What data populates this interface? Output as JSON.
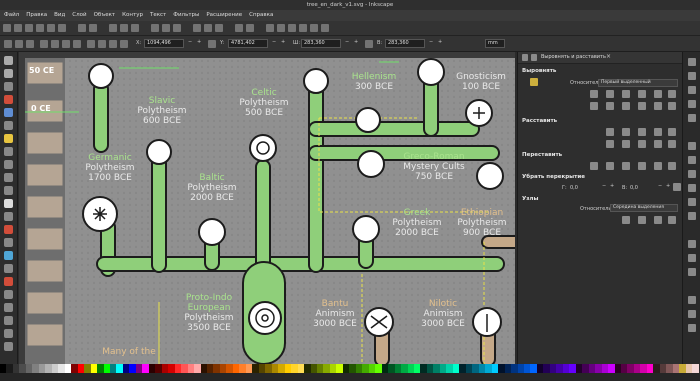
{
  "window": {
    "title": "tree_en_dark_v1.svg - Inkscape"
  },
  "menu": [
    "Файл",
    "Правка",
    "Вид",
    "Слой",
    "Объект",
    "Контур",
    "Текст",
    "Фильтры",
    "Расширение",
    "Справка"
  ],
  "coords": {
    "x_label": "X:",
    "x_value": "1094,496",
    "y_label": "Y:",
    "y_value": "4781,402",
    "w_label": "Ш:",
    "w_value": "283,360",
    "h_label": "В:",
    "h_value": "283,360",
    "unit": "mm"
  },
  "tab": {
    "label": "Выровнять и расставить"
  },
  "dialog": {
    "align_title": "Выровнять",
    "relative_label": "Относительно:",
    "relative_value": "Первый выделенный",
    "distribute_title": "Расставить",
    "rearrange_title": "Переставить",
    "remove_overlap_title": "Убрать перекрытие",
    "h_label": "Г:",
    "h_value": "0,0",
    "v_label": "В:",
    "v_value": "0,0",
    "nodes_title": "Узлы",
    "nodes_relative_label": "Относительно:",
    "nodes_relative_value": "Середина выделения"
  },
  "left_column": [
    "50 CE",
    "0 CE",
    "",
    "",
    "",
    "",
    "",
    "",
    "",
    "",
    "",
    ""
  ],
  "deities": [
    {
      "id": "hellenism",
      "name": "Hellenism",
      "type": "",
      "date": "300 BCE",
      "color": "green"
    },
    {
      "id": "gnosticism",
      "name": "Gnosticism",
      "type": "",
      "date": "100 BCE",
      "color": "white"
    },
    {
      "id": "slavic",
      "name": "Slavic",
      "type": "Polytheism",
      "date": "600 BCE",
      "color": "green"
    },
    {
      "id": "celtic",
      "name": "Celtic",
      "type": "Polytheism",
      "date": "500 BCE",
      "color": "green"
    },
    {
      "id": "germanic",
      "name": "Germanic",
      "type": "Polytheism",
      "date": "1700 BCE",
      "color": "green"
    },
    {
      "id": "baltic",
      "name": "Baltic",
      "type": "Polytheism",
      "date": "2000 BCE",
      "color": "green"
    },
    {
      "id": "greco-roman",
      "name": "Greco-Roman",
      "type": "Mystery Cults",
      "date": "750 BCE",
      "color": "green"
    },
    {
      "id": "greek",
      "name": "Greek",
      "type": "Polytheism",
      "date": "2000 BCE",
      "color": "green"
    },
    {
      "id": "ethiopian",
      "name": "Ethiopian",
      "type": "Polytheism",
      "date": "900 BCE",
      "color": "tan"
    },
    {
      "id": "proto-indo",
      "name": "Proto-Indo",
      "type": "European",
      "date": "Polytheism",
      "date2": "3500 BCE",
      "color": "green"
    },
    {
      "id": "bantu",
      "name": "Bantu",
      "type": "Animism",
      "date": "3000 BCE",
      "color": "tan"
    },
    {
      "id": "nilotic",
      "name": "Nilotic",
      "type": "Animism",
      "date": "3000 BCE",
      "color": "tan"
    }
  ],
  "footer_text": "Many of the",
  "colors": {
    "green": "#a9e38d",
    "tan": "#e3c08d",
    "branch": "#8fcf7a",
    "canvas": "#8e8e8e",
    "outline": "#1c1c1c"
  }
}
